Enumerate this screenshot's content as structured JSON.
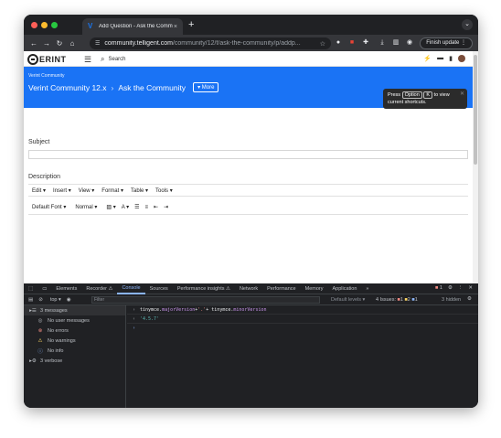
{
  "colors": {
    "brand_blue": "#1a73f5",
    "window_bg": "#202124",
    "toolbar_bg": "#35363a",
    "console_blue": "#8ab4f8"
  },
  "tab": {
    "title": "Add Question - Ask the Comm",
    "close": "×",
    "new": "+"
  },
  "toolbar": {
    "url_host": "community.telligent.com",
    "url_path": "/community/12/f/ask-the-community/p/addp...",
    "update_label": "Finish update"
  },
  "site": {
    "logo_text": "ERINT",
    "search_label": "Search",
    "crumb_small": "Verint Community",
    "crumb_community": "Verint Community 12.x",
    "crumb_forum": "Ask the Community",
    "more_label": "More",
    "tooltip": {
      "press": "Press",
      "key1": "Option",
      "key2": "K",
      "to_view": "to view",
      "rest": "current shortcuts."
    }
  },
  "form": {
    "subject_label": "Subject",
    "description_label": "Description",
    "menu": [
      "Edit ▾",
      "Insert ▾",
      "View ▾",
      "Format ▾",
      "Table ▾",
      "Tools ▾"
    ],
    "font_select": "Default Font",
    "size_select": "Normal"
  },
  "devtools": {
    "tabs": [
      "Elements",
      "Recorder ⚠",
      "Console",
      "Sources",
      "Performance insights ⚠",
      "Network",
      "Performance",
      "Memory",
      "Application",
      "»"
    ],
    "context": "top ▾",
    "filter_placeholder": "Filter",
    "levels": "Default levels ▾",
    "issues_label": "4 Issues:",
    "issues_red": "1",
    "issues_orange": "2",
    "issues_blue": "1",
    "hidden": "3 hidden",
    "error_badge": "1",
    "sidebar": [
      {
        "icon": "list",
        "label": "3 messages"
      },
      {
        "icon": "user",
        "label": "No user messages"
      },
      {
        "icon": "error",
        "label": "No errors"
      },
      {
        "icon": "warning",
        "label": "No warnings"
      },
      {
        "icon": "info",
        "label": "No info"
      },
      {
        "icon": "verbose",
        "label": "3 verbose"
      }
    ],
    "console": {
      "input_a": "tinymce.",
      "input_b": "majorVersion",
      "input_c": " + ",
      "input_d": "'.'",
      "input_e": " + tinymce.",
      "input_f": "minorVersion",
      "result": "'4.5.7'"
    }
  }
}
